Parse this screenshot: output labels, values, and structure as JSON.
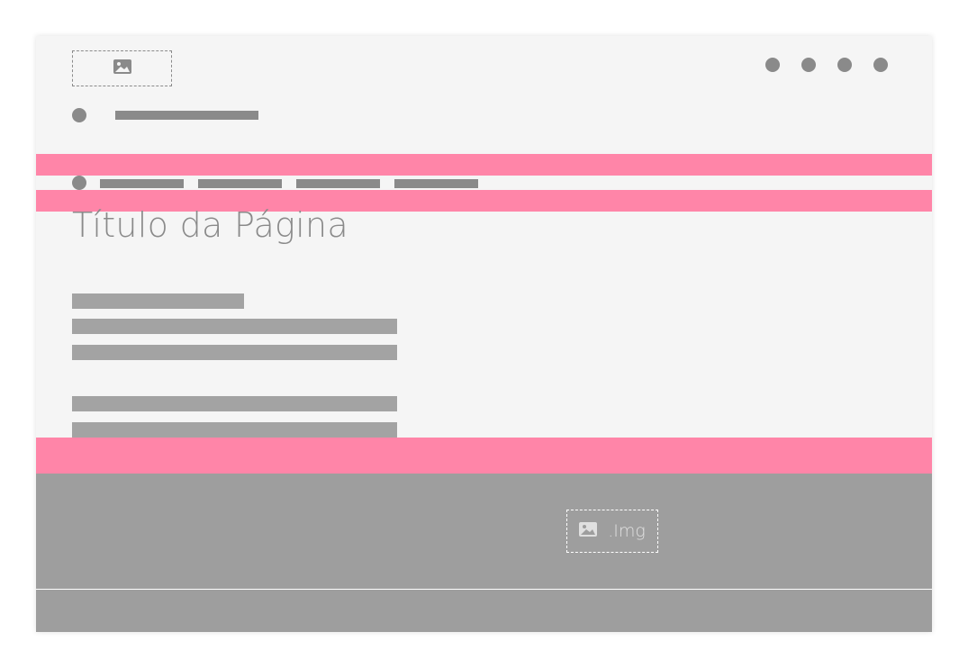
{
  "page": {
    "title": "Título da Página"
  },
  "footer": {
    "image_label": ".Img"
  },
  "header": {
    "nav_dot_count": 4
  },
  "colors": {
    "background": "#f5f5f5",
    "placeholder_gray": "#8a8a8a",
    "text_bar_gray": "#a3a3a3",
    "highlight_pink": "#ff85a8",
    "footer_gray": "#9e9e9e"
  },
  "icons": {
    "logo": "image-icon",
    "footer_image": "image-icon"
  }
}
